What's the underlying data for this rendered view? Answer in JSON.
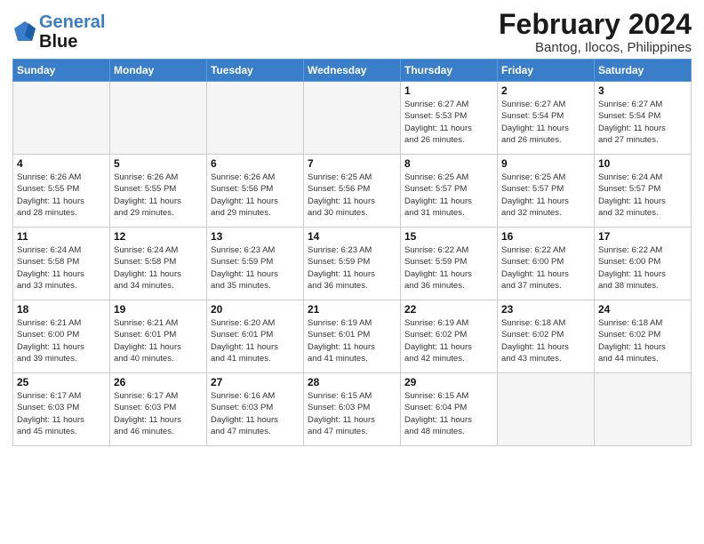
{
  "header": {
    "logo_line1": "General",
    "logo_line2": "Blue",
    "month": "February 2024",
    "location": "Bantog, Ilocos, Philippines"
  },
  "weekdays": [
    "Sunday",
    "Monday",
    "Tuesday",
    "Wednesday",
    "Thursday",
    "Friday",
    "Saturday"
  ],
  "weeks": [
    [
      {
        "day": "",
        "info": ""
      },
      {
        "day": "",
        "info": ""
      },
      {
        "day": "",
        "info": ""
      },
      {
        "day": "",
        "info": ""
      },
      {
        "day": "1",
        "info": "Sunrise: 6:27 AM\nSunset: 5:53 PM\nDaylight: 11 hours\nand 26 minutes."
      },
      {
        "day": "2",
        "info": "Sunrise: 6:27 AM\nSunset: 5:54 PM\nDaylight: 11 hours\nand 26 minutes."
      },
      {
        "day": "3",
        "info": "Sunrise: 6:27 AM\nSunset: 5:54 PM\nDaylight: 11 hours\nand 27 minutes."
      }
    ],
    [
      {
        "day": "4",
        "info": "Sunrise: 6:26 AM\nSunset: 5:55 PM\nDaylight: 11 hours\nand 28 minutes."
      },
      {
        "day": "5",
        "info": "Sunrise: 6:26 AM\nSunset: 5:55 PM\nDaylight: 11 hours\nand 29 minutes."
      },
      {
        "day": "6",
        "info": "Sunrise: 6:26 AM\nSunset: 5:56 PM\nDaylight: 11 hours\nand 29 minutes."
      },
      {
        "day": "7",
        "info": "Sunrise: 6:25 AM\nSunset: 5:56 PM\nDaylight: 11 hours\nand 30 minutes."
      },
      {
        "day": "8",
        "info": "Sunrise: 6:25 AM\nSunset: 5:57 PM\nDaylight: 11 hours\nand 31 minutes."
      },
      {
        "day": "9",
        "info": "Sunrise: 6:25 AM\nSunset: 5:57 PM\nDaylight: 11 hours\nand 32 minutes."
      },
      {
        "day": "10",
        "info": "Sunrise: 6:24 AM\nSunset: 5:57 PM\nDaylight: 11 hours\nand 32 minutes."
      }
    ],
    [
      {
        "day": "11",
        "info": "Sunrise: 6:24 AM\nSunset: 5:58 PM\nDaylight: 11 hours\nand 33 minutes."
      },
      {
        "day": "12",
        "info": "Sunrise: 6:24 AM\nSunset: 5:58 PM\nDaylight: 11 hours\nand 34 minutes."
      },
      {
        "day": "13",
        "info": "Sunrise: 6:23 AM\nSunset: 5:59 PM\nDaylight: 11 hours\nand 35 minutes."
      },
      {
        "day": "14",
        "info": "Sunrise: 6:23 AM\nSunset: 5:59 PM\nDaylight: 11 hours\nand 36 minutes."
      },
      {
        "day": "15",
        "info": "Sunrise: 6:22 AM\nSunset: 5:59 PM\nDaylight: 11 hours\nand 36 minutes."
      },
      {
        "day": "16",
        "info": "Sunrise: 6:22 AM\nSunset: 6:00 PM\nDaylight: 11 hours\nand 37 minutes."
      },
      {
        "day": "17",
        "info": "Sunrise: 6:22 AM\nSunset: 6:00 PM\nDaylight: 11 hours\nand 38 minutes."
      }
    ],
    [
      {
        "day": "18",
        "info": "Sunrise: 6:21 AM\nSunset: 6:00 PM\nDaylight: 11 hours\nand 39 minutes."
      },
      {
        "day": "19",
        "info": "Sunrise: 6:21 AM\nSunset: 6:01 PM\nDaylight: 11 hours\nand 40 minutes."
      },
      {
        "day": "20",
        "info": "Sunrise: 6:20 AM\nSunset: 6:01 PM\nDaylight: 11 hours\nand 41 minutes."
      },
      {
        "day": "21",
        "info": "Sunrise: 6:19 AM\nSunset: 6:01 PM\nDaylight: 11 hours\nand 41 minutes."
      },
      {
        "day": "22",
        "info": "Sunrise: 6:19 AM\nSunset: 6:02 PM\nDaylight: 11 hours\nand 42 minutes."
      },
      {
        "day": "23",
        "info": "Sunrise: 6:18 AM\nSunset: 6:02 PM\nDaylight: 11 hours\nand 43 minutes."
      },
      {
        "day": "24",
        "info": "Sunrise: 6:18 AM\nSunset: 6:02 PM\nDaylight: 11 hours\nand 44 minutes."
      }
    ],
    [
      {
        "day": "25",
        "info": "Sunrise: 6:17 AM\nSunset: 6:03 PM\nDaylight: 11 hours\nand 45 minutes."
      },
      {
        "day": "26",
        "info": "Sunrise: 6:17 AM\nSunset: 6:03 PM\nDaylight: 11 hours\nand 46 minutes."
      },
      {
        "day": "27",
        "info": "Sunrise: 6:16 AM\nSunset: 6:03 PM\nDaylight: 11 hours\nand 47 minutes."
      },
      {
        "day": "28",
        "info": "Sunrise: 6:15 AM\nSunset: 6:03 PM\nDaylight: 11 hours\nand 47 minutes."
      },
      {
        "day": "29",
        "info": "Sunrise: 6:15 AM\nSunset: 6:04 PM\nDaylight: 11 hours\nand 48 minutes."
      },
      {
        "day": "",
        "info": ""
      },
      {
        "day": "",
        "info": ""
      }
    ]
  ]
}
